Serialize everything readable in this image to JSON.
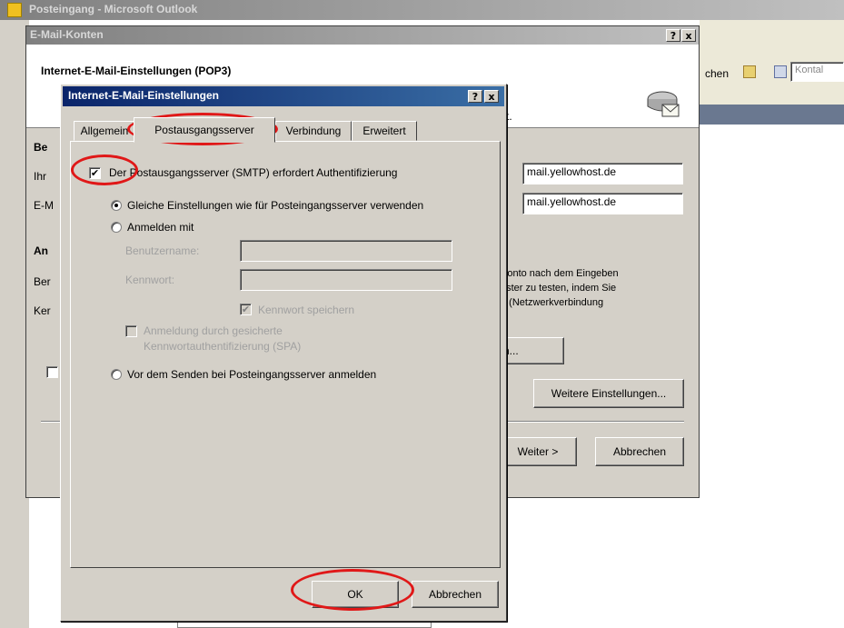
{
  "outlook": {
    "title": "Posteingang - Microsoft Outlook",
    "toolbar_suchen": "chen",
    "toolbar_kontakt": "Kontal"
  },
  "accounts": {
    "title": "E-Mail-Konten",
    "help_label": "?",
    "close_label": "x",
    "header_title": "Internet-E-Mail-Einstellungen (POP3)",
    "header_subtitle_fragment": "t.",
    "section_ber": "Be",
    "row_ihr": "Ihr",
    "row_email": "E-M",
    "section_an": "An",
    "row_ben": "Ber",
    "row_ken": "Ker",
    "incoming_server_value": "mail.yellowhost.de",
    "outgoing_server_value": "mail.yellowhost.de",
    "info_text": [
      "Konto nach dem Eingeben",
      "nster zu testen, indem Sie",
      "n (Netzwerkverbindung"
    ],
    "test_button": "n...",
    "more_settings_button": "Weitere Einstellungen...",
    "next_button": "Weiter >",
    "cancel_button": "Abbrechen"
  },
  "dialog": {
    "title": "Internet-E-Mail-Einstellungen",
    "help_label": "?",
    "close_label": "x",
    "tabs": [
      "Allgemein",
      "Postausgangsserver",
      "Verbindung",
      "Erweitert"
    ],
    "smtp_auth_label": "Der Postausgangsserver (SMTP) erfordert Authentifizierung",
    "smtp_auth_checked": true,
    "same_settings_label": "Gleiche Einstellungen wie für Posteingangsserver verwenden",
    "login_with_label": "Anmelden mit",
    "username_label": "Benutzername:",
    "password_label": "Kennwort:",
    "save_password_label": "Kennwort speichern",
    "spa_label_line1": "Anmeldung durch gesicherte",
    "spa_label_line2": "Kennwortauthentifizierung (SPA)",
    "pop_before_smtp_label": "Vor dem Senden bei Posteingangsserver anmelden",
    "ok_button": "OK",
    "cancel_button": "Abbrechen"
  },
  "colors": {
    "dialog_bg": "#d4d0c8",
    "title_active": "#0a246a",
    "highlight_circle": "#e01818"
  }
}
